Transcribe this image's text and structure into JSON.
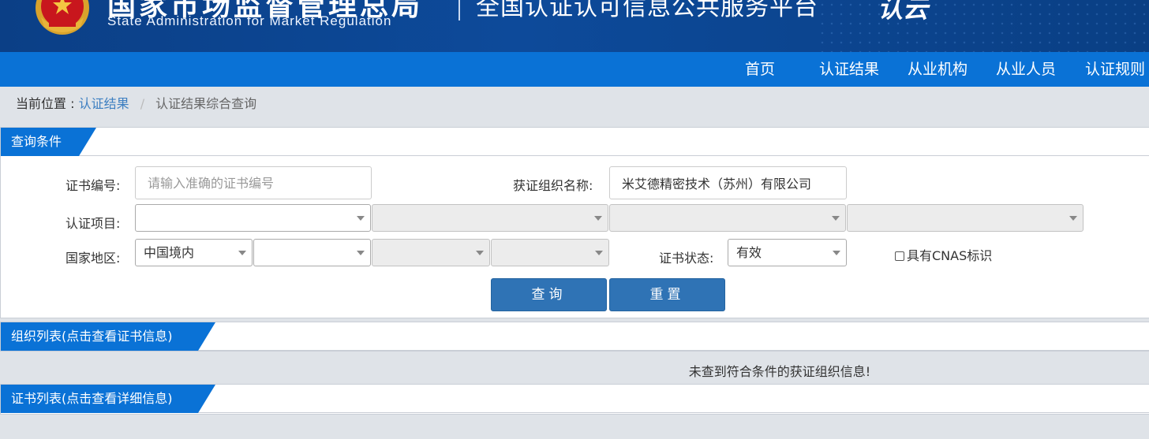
{
  "header": {
    "agency_cn": "国家市场监督管理总局",
    "agency_en": "State Administration  for  Market Regulation",
    "platform_title": "全国认证认可信息公共服务平台",
    "logo_text": "认云"
  },
  "nav": {
    "items": [
      {
        "label": "首页"
      },
      {
        "label": "认证结果"
      },
      {
        "label": "从业机构"
      },
      {
        "label": "从业人员"
      },
      {
        "label": "认证规则"
      }
    ]
  },
  "breadcrumb": {
    "prefix": "当前位置 :",
    "link": "认证结果",
    "separator": "/",
    "current": "认证结果综合查询"
  },
  "query_panel": {
    "title": "查询条件",
    "cert_no_label": "证书编号:",
    "cert_no_value": "",
    "cert_no_placeholder": "请输入准确的证书编号",
    "org_name_label": "获证组织名称:",
    "org_name_value": "米艾德精密技术（苏州）有限公司",
    "project_label": "认证项目:",
    "project_selects": [
      "",
      "",
      "",
      ""
    ],
    "region_label": "国家地区:",
    "region_selects": [
      "中国境内",
      "",
      "",
      ""
    ],
    "status_label": "证书状态:",
    "status_value": "有效",
    "cnas_label": "具有CNAS标识",
    "cnas_checked": false,
    "query_button": "查询",
    "reset_button": "重置"
  },
  "org_list": {
    "title": "组织列表(点击查看证书信息)",
    "empty_message": "未查到符合条件的获证组织信息!"
  },
  "cert_list": {
    "title": "证书列表(点击查看详细信息)"
  },
  "colors": {
    "header_bg": "#0b3f86",
    "nav_bg": "#0a72d6",
    "button_bg": "#2f73b5",
    "page_bg": "#dfe3e8",
    "link": "#3d7fc1"
  }
}
